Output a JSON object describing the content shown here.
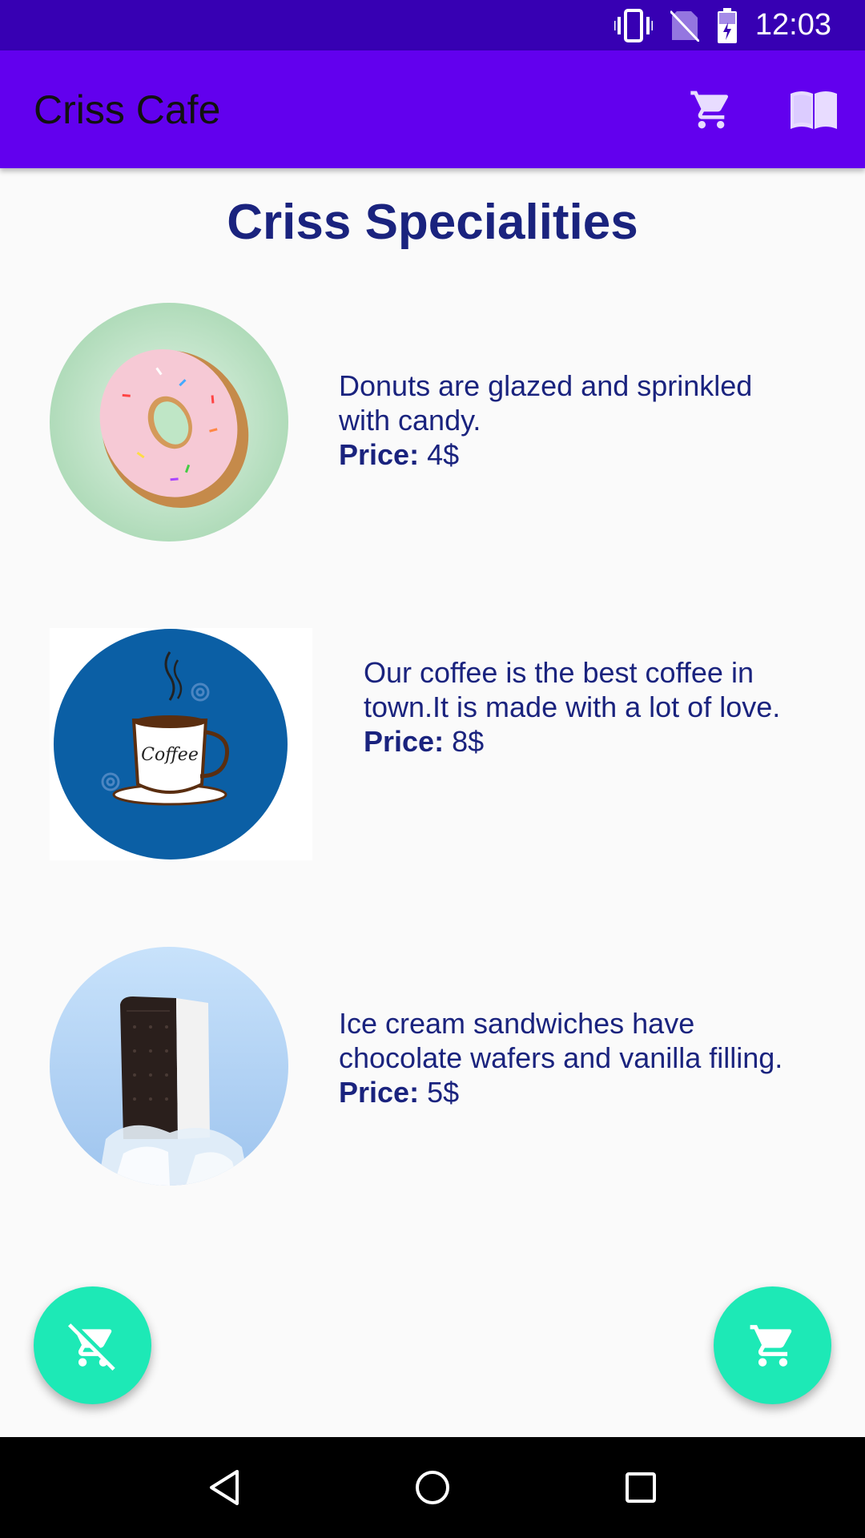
{
  "status_bar": {
    "time": "12:03",
    "icons": [
      "vibrate-icon",
      "no-sim-icon",
      "battery-charging-icon"
    ]
  },
  "app_bar": {
    "title": "Criss Cafe",
    "actions": [
      "cart-icon",
      "menu-book-icon"
    ]
  },
  "page": {
    "heading": "Criss Specialities"
  },
  "items": [
    {
      "image_icon": "donut-image",
      "description": "Donuts are glazed and sprinkled with candy.",
      "price_label": "Price:",
      "price_value": " 4$"
    },
    {
      "image_icon": "coffee-image",
      "description": "Our coffee is the best coffee in town.It is made with a lot of love.",
      "price_label": "Price:",
      "price_value": " 8$",
      "image_text": "Coffee"
    },
    {
      "image_icon": "ice-cream-sandwich-image",
      "description": "Ice cream sandwiches have chocolate wafers and vanilla filling.",
      "price_label": "Price:",
      "price_value": " 5$"
    }
  ],
  "fabs": {
    "left_icon": "remove-shopping-cart-icon",
    "right_icon": "add-shopping-cart-icon"
  },
  "nav_bar": {
    "buttons": [
      "back-icon",
      "home-icon",
      "recents-icon"
    ]
  },
  "colors": {
    "status_bar": "#3700b3",
    "app_bar": "#6200ee",
    "text_primary": "#1a237e",
    "fab": "#1de9b6"
  }
}
